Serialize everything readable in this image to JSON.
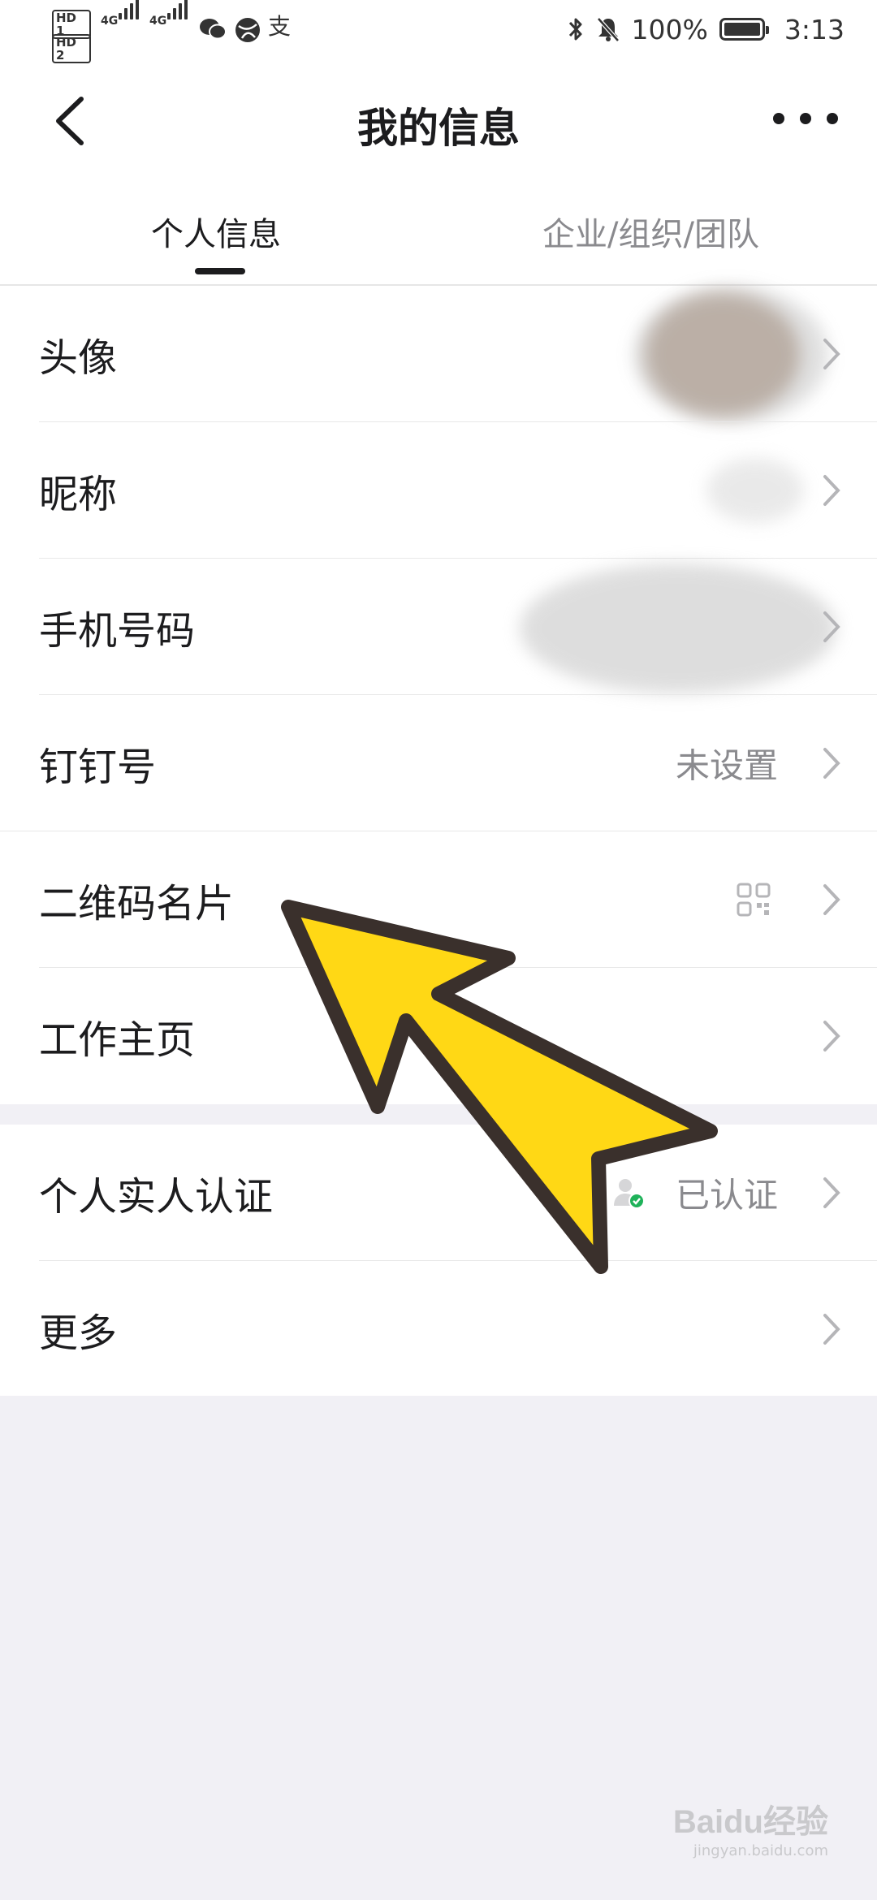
{
  "status_bar": {
    "sim1": "HD 1",
    "sim2": "HD 2",
    "net1": "4G",
    "net2": "4G",
    "alipay_glyph": "支",
    "battery": "100%",
    "time": "3:13",
    "icons": [
      "wechat-icon",
      "browser-icon",
      "alipay-icon",
      "bluetooth-icon",
      "bell-muted-icon",
      "battery-icon"
    ]
  },
  "header": {
    "title": "我的信息",
    "back_icon": "chevron-left-icon",
    "more_icon": "more-dots-icon"
  },
  "tabs": [
    {
      "label": "个人信息",
      "active": true
    },
    {
      "label": "企业/组织/团队",
      "active": false
    }
  ],
  "rows_main": [
    {
      "label": "头像",
      "value": ""
    },
    {
      "label": "昵称",
      "value": ""
    },
    {
      "label": "手机号码",
      "value": ""
    },
    {
      "label": "钉钉号",
      "value": "未设置"
    },
    {
      "label": "二维码名片",
      "value": ""
    },
    {
      "label": "工作主页",
      "value": ""
    }
  ],
  "rows_verify": [
    {
      "label": "个人实人认证",
      "value": "已认证"
    },
    {
      "label": "更多",
      "value": ""
    }
  ],
  "colors": {
    "background": "#f1f0f5",
    "arrow_fill": "#ffd815",
    "arrow_stroke": "#3a302c",
    "verified_green": "#1fb25a"
  },
  "watermark": {
    "logo": "Baidu经验",
    "url": "jingyan.baidu.com"
  }
}
